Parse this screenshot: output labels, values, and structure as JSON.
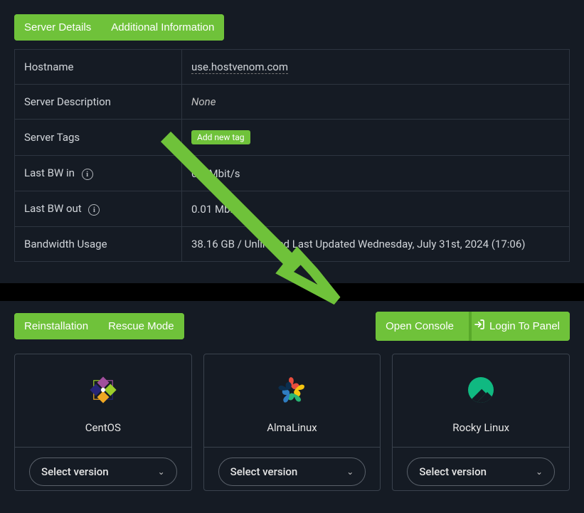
{
  "tabs": {
    "server_details": "Server Details",
    "additional_info": "Additional Information"
  },
  "details": {
    "hostname_label": "Hostname",
    "hostname_value": "use.hostvenom.com",
    "description_label": "Server Description",
    "description_value": "None",
    "tags_label": "Server Tags",
    "add_tag_label": "Add new tag",
    "bw_in_label": "Last BW in",
    "bw_in_value": "0.0   Mbit/s",
    "bw_out_label": "Last BW out",
    "bw_out_value": "0.01 Mbit/s",
    "bw_usage_label": "Bandwidth Usage",
    "bw_usage_value": "38.16 GB / Unlimited    Last Updated Wednesday, July 31st, 2024 (17:06)"
  },
  "actions": {
    "reinstallation": "Reinstallation",
    "rescue_mode": "Rescue Mode",
    "open_console": "Open Console",
    "login_to_panel": "Login To Panel"
  },
  "os": {
    "centos": "CentOS",
    "almalinux": "AlmaLinux",
    "rockylinux": "Rocky Linux",
    "select_version": "Select version"
  }
}
